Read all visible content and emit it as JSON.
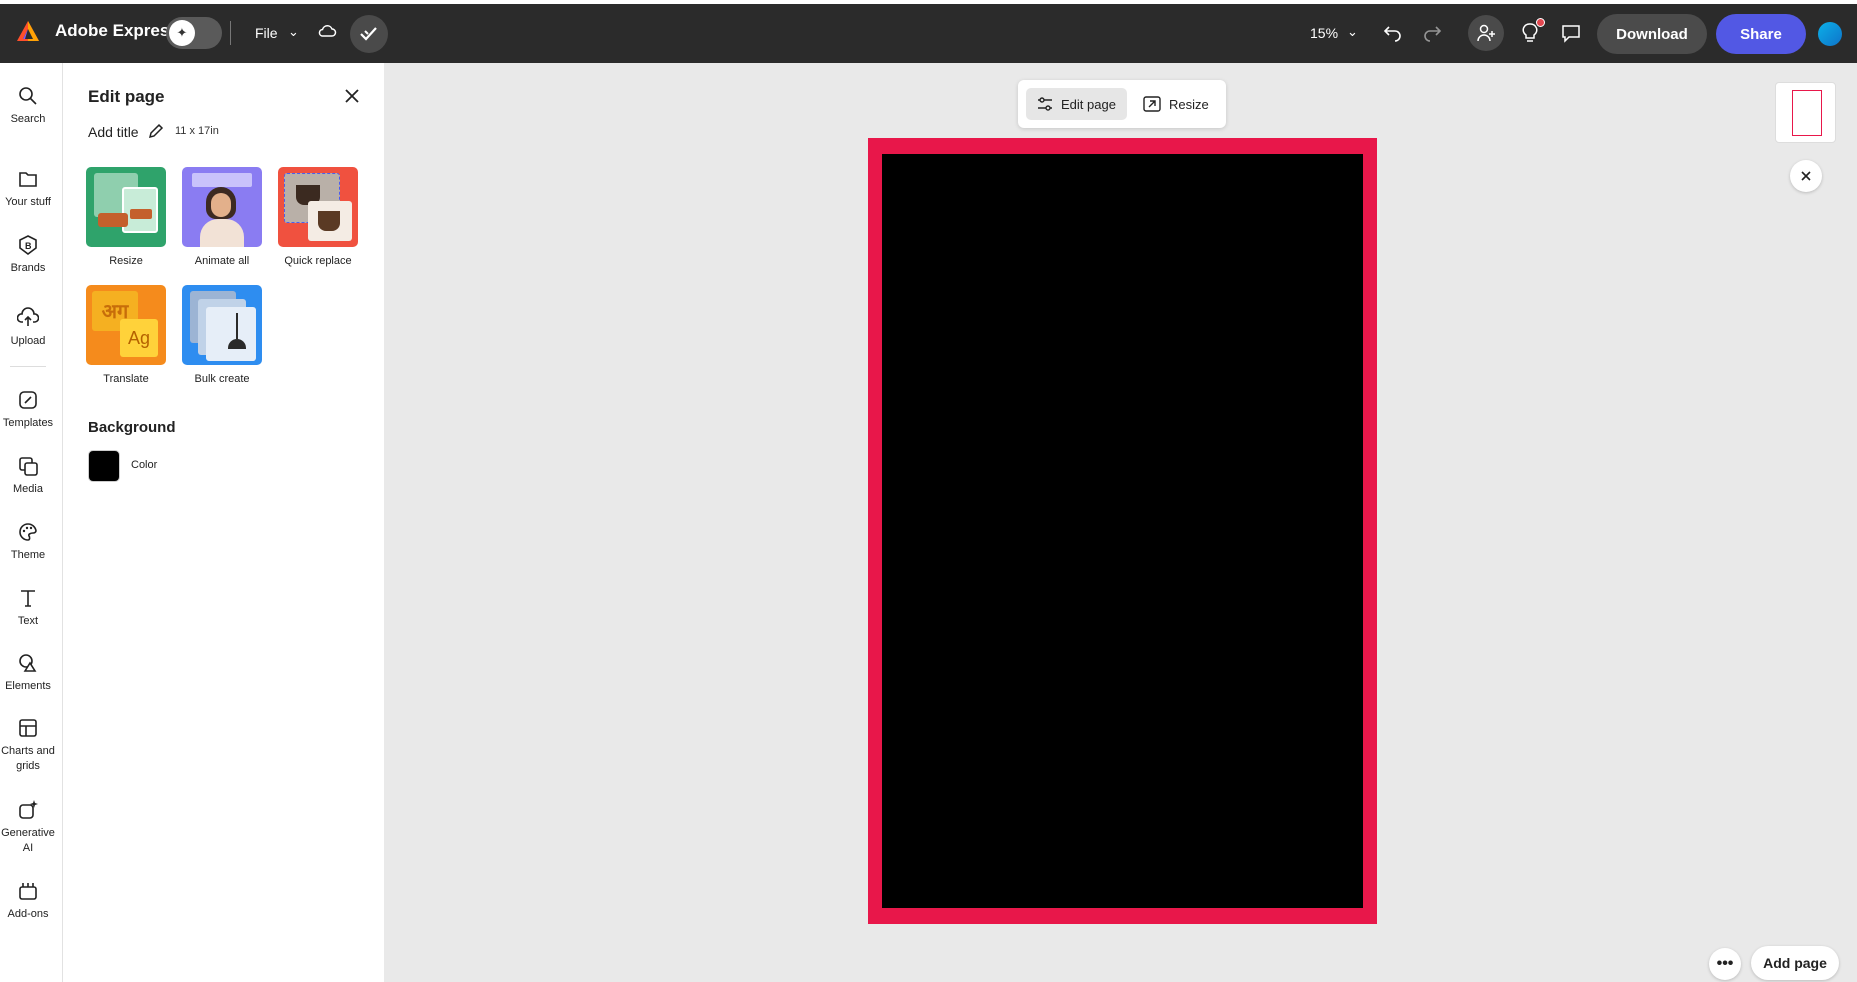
{
  "header": {
    "app_title": "Adobe Express",
    "file_label": "File",
    "zoom": "15%",
    "download_label": "Download",
    "share_label": "Share"
  },
  "rail": {
    "items": [
      {
        "label": "Search",
        "icon": "search-icon"
      },
      {
        "label": "Your stuff",
        "icon": "folder-icon"
      },
      {
        "label": "Brands",
        "icon": "brand-icon"
      },
      {
        "label": "Upload",
        "icon": "upload-icon"
      },
      {
        "label": "Templates",
        "icon": "templates-icon"
      },
      {
        "label": "Media",
        "icon": "media-icon"
      },
      {
        "label": "Theme",
        "icon": "palette-icon"
      },
      {
        "label": "Text",
        "icon": "text-icon"
      },
      {
        "label": "Elements",
        "icon": "shapes-icon"
      },
      {
        "label": "Charts and grids",
        "icon": "grid-icon"
      },
      {
        "label": "Generative AI",
        "icon": "sparkle-icon"
      },
      {
        "label": "Add-ons",
        "icon": "addons-icon"
      }
    ]
  },
  "panel": {
    "title": "Edit page",
    "add_title": "Add title",
    "size": "11 x 17in",
    "tiles": [
      {
        "label": "Resize"
      },
      {
        "label": "Animate all"
      },
      {
        "label": "Quick replace"
      },
      {
        "label": "Translate"
      },
      {
        "label": "Bulk create"
      }
    ],
    "background_heading": "Background",
    "color_label": "Color",
    "background_color": "#000000"
  },
  "canvas": {
    "toolbar_edit_label": "Edit page",
    "toolbar_resize_label": "Resize",
    "add_page_label": "Add page",
    "border_color": "#e8174a"
  }
}
